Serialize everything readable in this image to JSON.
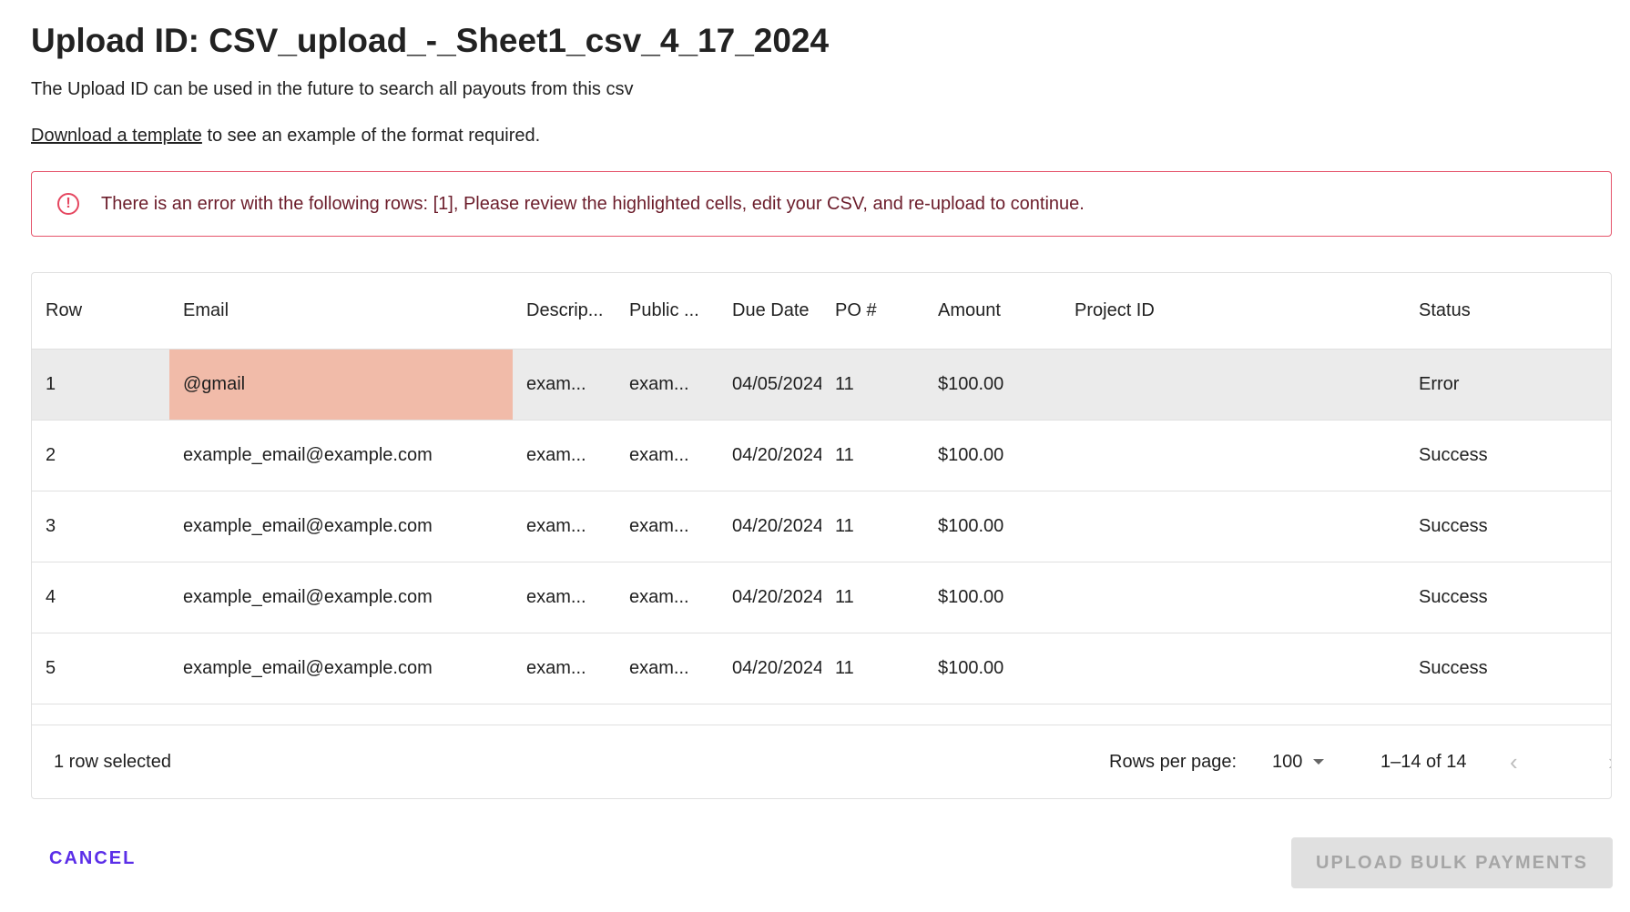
{
  "title": "Upload ID: CSV_upload_-_Sheet1_csv_4_17_2024",
  "subtitle": "The Upload ID can be used in the future to search all payouts from this csv",
  "template_link": "Download a template",
  "template_rest": " to see an example of the format required.",
  "alert": {
    "icon": "error-outline-icon",
    "text": "There is an error with the following rows: [1], Please review the highlighted cells, edit your CSV, and re-upload to continue."
  },
  "table": {
    "columns": [
      "Row",
      "Email",
      "Descrip...",
      "Public ...",
      "Due Date",
      "PO #",
      "Amount",
      "Project ID",
      "Status"
    ],
    "rows": [
      [
        "1",
        "@gmail",
        "exam...",
        "exam...",
        "04/05/2024",
        "11",
        "$100.00",
        "",
        "Error"
      ],
      [
        "2",
        "example_email@example.com",
        "exam...",
        "exam...",
        "04/20/2024",
        "11",
        "$100.00",
        "",
        "Success"
      ],
      [
        "3",
        "example_email@example.com",
        "exam...",
        "exam...",
        "04/20/2024",
        "11",
        "$100.00",
        "",
        "Success"
      ],
      [
        "4",
        "example_email@example.com",
        "exam...",
        "exam...",
        "04/20/2024",
        "11",
        "$100.00",
        "",
        "Success"
      ],
      [
        "5",
        "example_email@example.com",
        "exam...",
        "exam...",
        "04/20/2024",
        "11",
        "$100.00",
        "",
        "Success"
      ]
    ]
  },
  "footer": {
    "selected": "1 row selected",
    "rows_per_page_label": "Rows per page:",
    "rows_per_page": "100",
    "range": "1–14 of 14",
    "prev": "‹",
    "next": "›"
  },
  "actions": {
    "cancel": "CANCEL",
    "upload": "UPLOAD BULK PAYMENTS"
  },
  "colors": {
    "error_cell": "#f1bba9",
    "accent": "#5b2ee8",
    "alert_border": "#e5546b"
  }
}
